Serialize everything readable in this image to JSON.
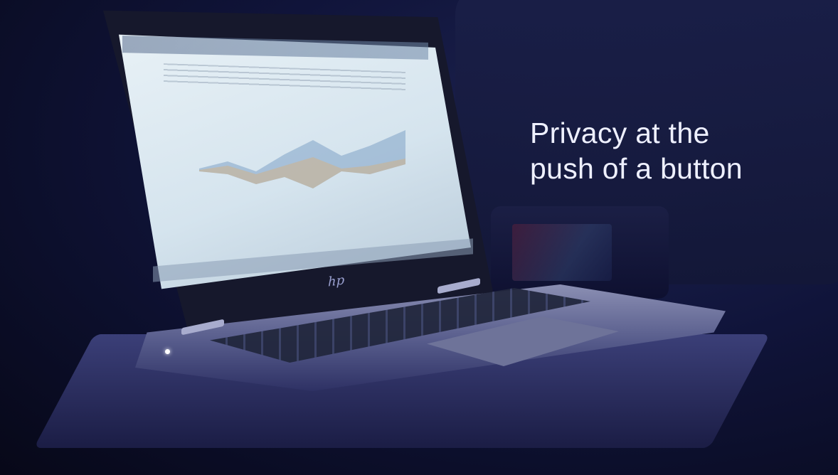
{
  "tagline": {
    "line1": "Privacy at the",
    "line2": "push of a button"
  },
  "laptop": {
    "logo": "hp"
  },
  "colors": {
    "background": "#10143a",
    "tagline_text": "#eef0ff",
    "screen": "#dbe7f0"
  }
}
